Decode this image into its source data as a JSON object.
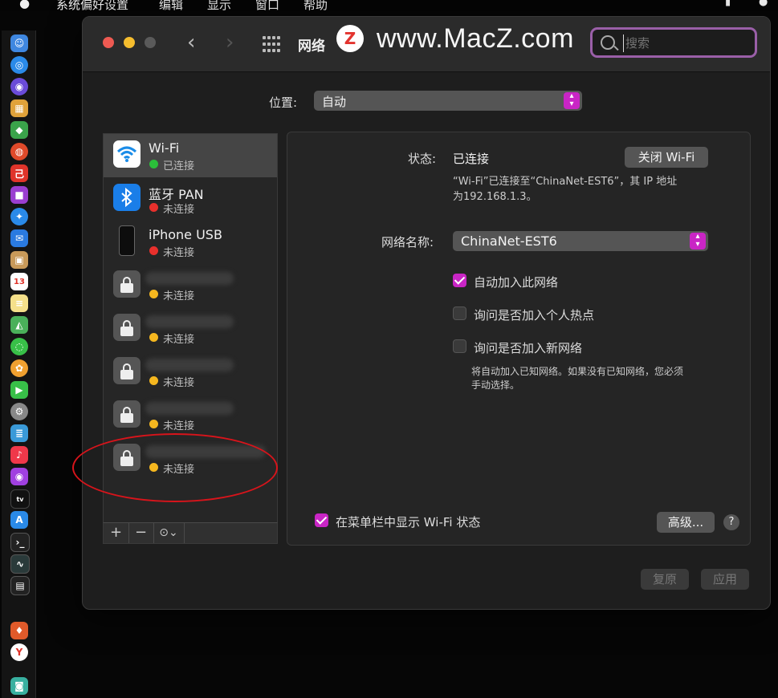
{
  "menubar": {
    "apple": "",
    "items": [
      "系统偏好设置",
      "编辑",
      "显示",
      "窗口",
      "帮助"
    ]
  },
  "window": {
    "title": "网络",
    "search_placeholder": "搜索",
    "watermark": "www.MacZ.com",
    "watermark_logo": "Z"
  },
  "location": {
    "label": "位置:",
    "value": "自动"
  },
  "services": [
    {
      "name": "Wi-Fi",
      "status": "已连接",
      "status_color": "#2bbf3a",
      "icon": "wifi-icon",
      "selected": true
    },
    {
      "name": "蓝牙 PAN",
      "status": "未连接",
      "status_color": "#e8302c",
      "icon": "bluetooth-icon"
    },
    {
      "name": "iPhone USB",
      "status": "未连接",
      "status_color": "#e8302c",
      "icon": "iphone-icon"
    },
    {
      "name": "",
      "status": "未连接",
      "status_color": "#f5b71f",
      "icon": "lock-icon"
    },
    {
      "name": "",
      "status": "未连接",
      "status_color": "#f5b71f",
      "icon": "lock-icon"
    },
    {
      "name": "",
      "status": "未连接",
      "status_color": "#f5b71f",
      "icon": "lock-icon"
    },
    {
      "name": "",
      "status": "未连接",
      "status_color": "#f5b71f",
      "icon": "lock-icon"
    },
    {
      "name": "",
      "status": "未连接",
      "status_color": "#f5b71f",
      "icon": "lock-icon"
    }
  ],
  "list_toolbar": {
    "add": "+",
    "remove": "−",
    "action": "⊙⌄"
  },
  "detail": {
    "status_label": "状态:",
    "status_value": "已连接",
    "turn_off_button": "关闭 Wi-Fi",
    "status_desc_line1": "“Wi-Fi”已连接至“ChinaNet-EST6”，其 IP 地址",
    "status_desc_line2": "为192.168.1.3。",
    "network_name_label": "网络名称:",
    "network_name_value": "ChinaNet-EST6",
    "auto_join": "自动加入此网络",
    "ask_hotspot": "询问是否加入个人热点",
    "ask_new": "询问是否加入新网络",
    "ask_new_desc_line1": "将自动加入已知网络。如果没有已知网络，您必须",
    "ask_new_desc_line2": "手动选择。",
    "show_in_menubar": "在菜单栏中显示 Wi-Fi 状态",
    "advanced_button": "高级...",
    "help_button": "?"
  },
  "footer": {
    "revert_button": "复原",
    "apply_button": "应用"
  },
  "colors": {
    "accent": "#c925c5",
    "connected": "#2bbf3a",
    "error": "#e8302c",
    "warning": "#f5b71f",
    "annotation": "#d8141b"
  }
}
